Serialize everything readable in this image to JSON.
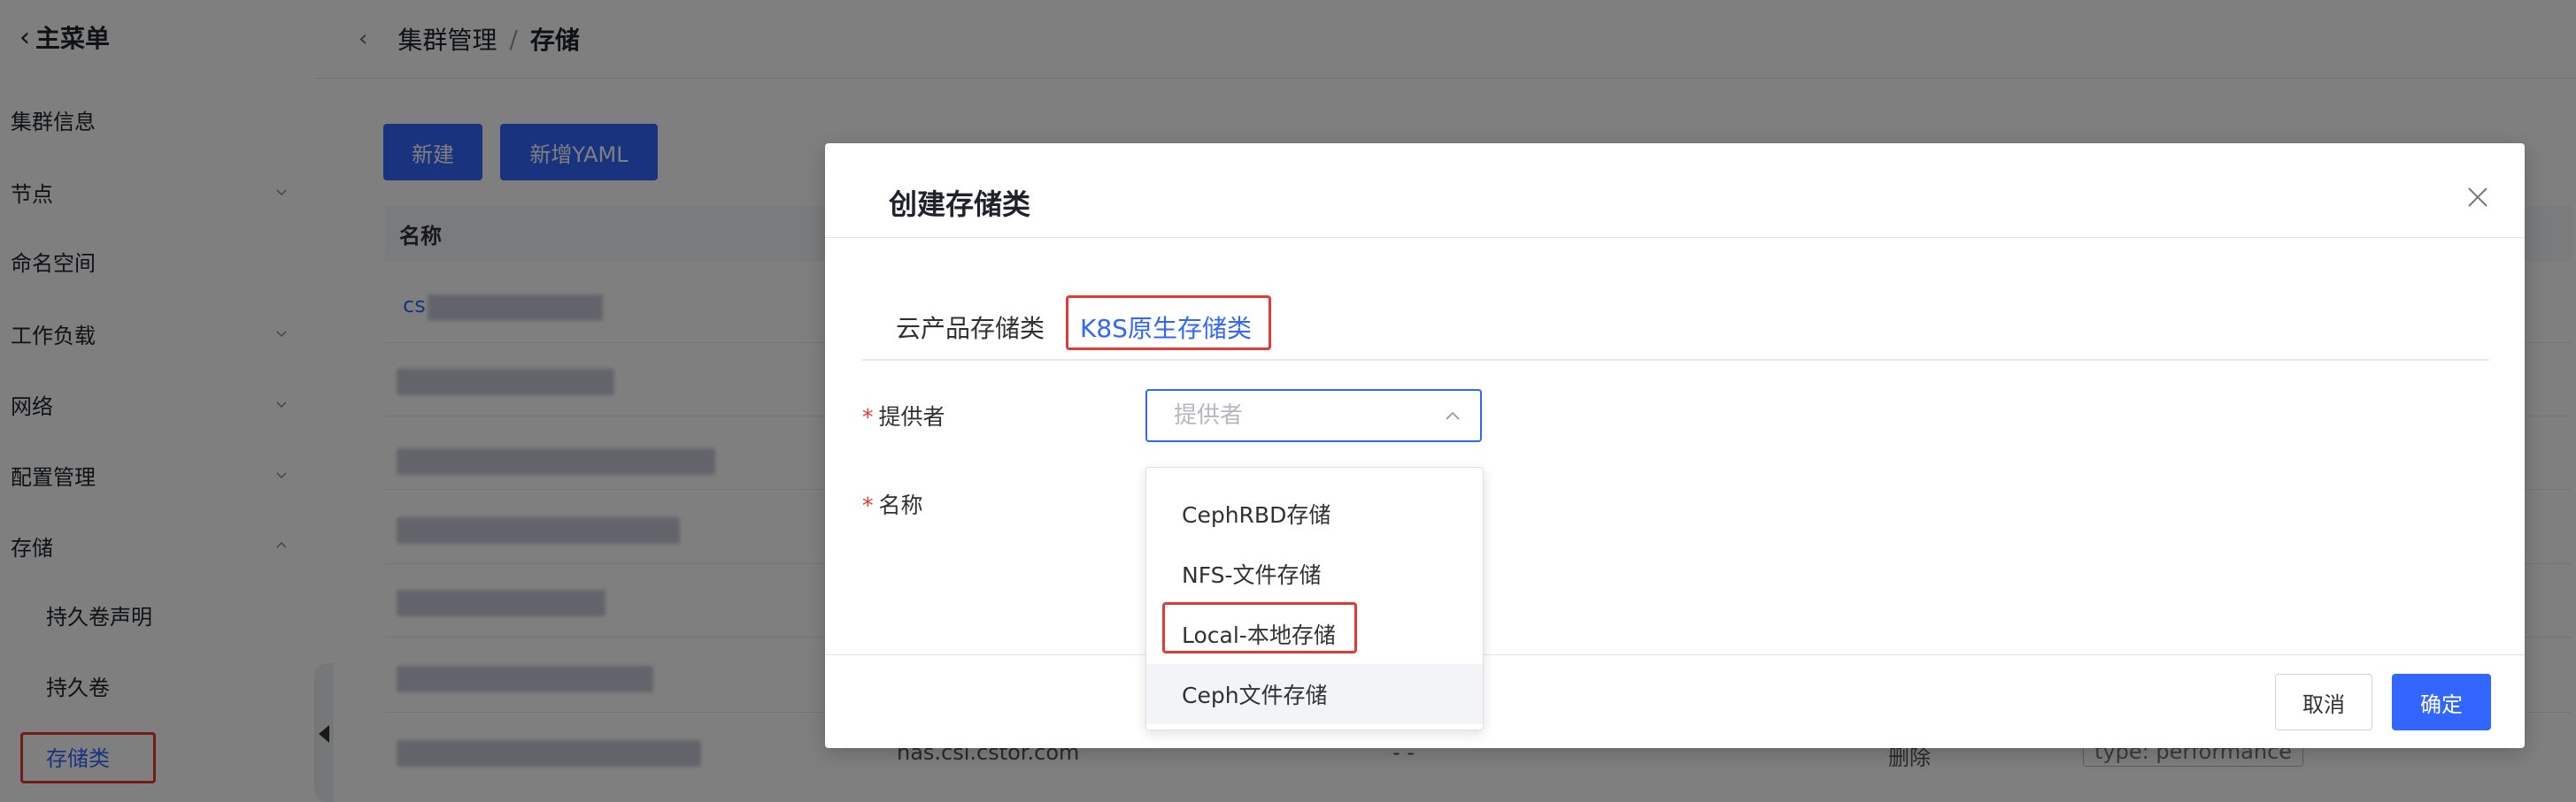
{
  "sidebar": {
    "back_label": "主菜单",
    "items": [
      {
        "label": "集群信息"
      },
      {
        "label": "节点"
      },
      {
        "label": "命名空间"
      },
      {
        "label": "工作负载"
      },
      {
        "label": "网络"
      },
      {
        "label": "配置管理"
      },
      {
        "label": "存储"
      },
      {
        "label": "持久卷声明"
      },
      {
        "label": "持久卷"
      },
      {
        "label": "存储类"
      }
    ]
  },
  "breadcrumb": {
    "parent": "集群管理",
    "separator": "/",
    "current": "存储"
  },
  "toolbar": {
    "new_label": "新建",
    "new_yaml_label": "新增YAML"
  },
  "table": {
    "name_header": "名称",
    "first_row_prefix": "cs",
    "last_row": {
      "provisioner": "nas.csi.cstor.com",
      "reclaim": "- -",
      "action": "删除",
      "param_tag": "type: performance"
    }
  },
  "modal": {
    "title": "创建存储类",
    "tabs": [
      {
        "label": "云产品存储类"
      },
      {
        "label": "K8S原生存储类"
      }
    ],
    "active_tab": "K8S原生存储类",
    "provider_label": "提供者",
    "provider_placeholder": "提供者",
    "name_label": "名称",
    "cancel_label": "取消",
    "confirm_label": "确定"
  },
  "dropdown": {
    "options": [
      {
        "label": "CephRBD存储"
      },
      {
        "label": "NFS-文件存储"
      },
      {
        "label": "Local-本地存储"
      },
      {
        "label": "Ceph文件存储"
      }
    ],
    "hovered": "Ceph文件存储",
    "highlighted": "Local-本地存储"
  },
  "colors": {
    "accent": "#3366ff",
    "highlight_border": "#e53935",
    "mask": "rgba(0,0,0,0.5)"
  }
}
